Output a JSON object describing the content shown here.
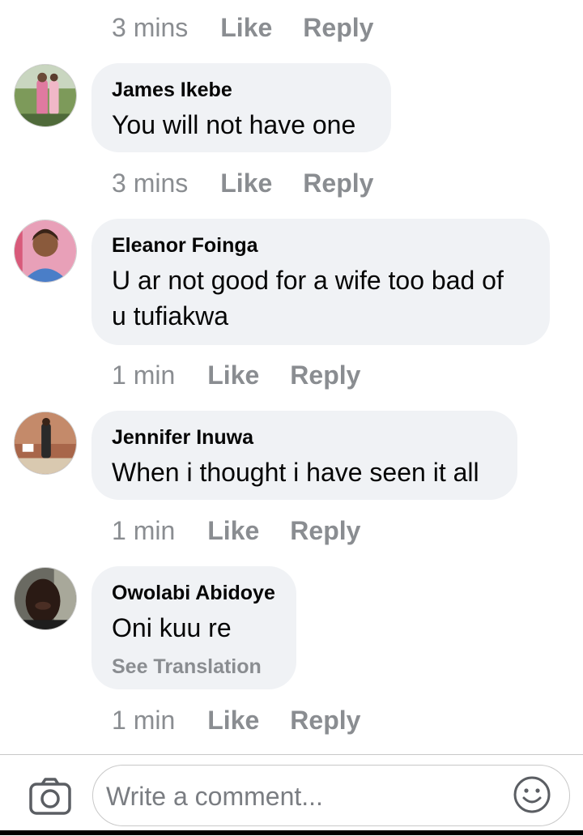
{
  "top_meta": {
    "time": "3 mins",
    "like": "Like",
    "reply": "Reply"
  },
  "comments": [
    {
      "author": "James Ikebe",
      "text": "You will not have one",
      "time": "3 mins",
      "like": "Like",
      "reply": "Reply"
    },
    {
      "author": "Eleanor Foinga",
      "text_line1": "U ar not good for a wife too bad of",
      "text_line2": "u tufiakwa",
      "time": "1 min",
      "like": "Like",
      "reply": "Reply"
    },
    {
      "author": "Jennifer Inuwa",
      "text": "When i thought i have seen it all",
      "time": "1 min",
      "like": "Like",
      "reply": "Reply"
    },
    {
      "author": "Owolabi Abidoye",
      "text": "Oni kuu re",
      "see_translation": "See Translation",
      "time": "1 min",
      "like": "Like",
      "reply": "Reply"
    }
  ],
  "composer": {
    "placeholder": "Write a comment...",
    "camera_icon": "camera-icon",
    "emoji_icon": "emoji-icon"
  }
}
